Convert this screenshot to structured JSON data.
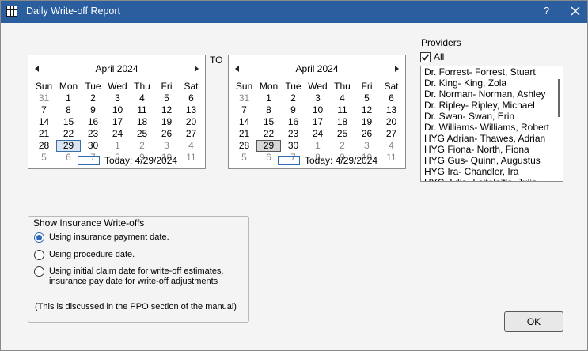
{
  "window": {
    "title": "Daily Write-off Report",
    "help_label": "?"
  },
  "to_label": "TO",
  "calendar_left": {
    "month": "April 2024",
    "weekdays": [
      "Sun",
      "Mon",
      "Tue",
      "Wed",
      "Thu",
      "Fri",
      "Sat"
    ],
    "weeks": [
      [
        "31",
        "1",
        "2",
        "3",
        "4",
        "5",
        "6"
      ],
      [
        "7",
        "8",
        "9",
        "10",
        "11",
        "12",
        "13"
      ],
      [
        "14",
        "15",
        "16",
        "17",
        "18",
        "19",
        "20"
      ],
      [
        "21",
        "22",
        "23",
        "24",
        "25",
        "26",
        "27"
      ],
      [
        "28",
        "29",
        "30",
        "1",
        "2",
        "3",
        "4"
      ],
      [
        "5",
        "6",
        "7",
        "8",
        "9",
        "10",
        "11"
      ]
    ],
    "today_label": "Today: 4/29/2024"
  },
  "calendar_right": {
    "month": "April 2024",
    "weekdays": [
      "Sun",
      "Mon",
      "Tue",
      "Wed",
      "Thu",
      "Fri",
      "Sat"
    ],
    "weeks": [
      [
        "31",
        "1",
        "2",
        "3",
        "4",
        "5",
        "6"
      ],
      [
        "7",
        "8",
        "9",
        "10",
        "11",
        "12",
        "13"
      ],
      [
        "14",
        "15",
        "16",
        "17",
        "18",
        "19",
        "20"
      ],
      [
        "21",
        "22",
        "23",
        "24",
        "25",
        "26",
        "27"
      ],
      [
        "28",
        "29",
        "30",
        "1",
        "2",
        "3",
        "4"
      ],
      [
        "5",
        "6",
        "7",
        "8",
        "9",
        "10",
        "11"
      ]
    ],
    "today_label": "Today: 4/29/2024"
  },
  "providers": {
    "label": "Providers",
    "all_label": "All",
    "all_checked": true,
    "items": [
      "Dr. Forrest- Forrest, Stuart",
      "Dr. King- King, Zola",
      "Dr. Norman- Norman, Ashley",
      "Dr. Ripley- Ripley, Michael",
      "Dr. Swan- Swan, Erin",
      "Dr. Williams- Williams, Robert",
      "HYG Adrian- Thawes, Adrian",
      "HYG Fiona- North, Fiona",
      "HYG Gus- Quinn, Augustus",
      "HYG Ira- Chandler, Ira",
      "HYG Julia- Laitelaitis, Julia"
    ]
  },
  "insurance_writeoffs": {
    "label": "Show Insurance Write-offs",
    "option1": "Using insurance payment date.",
    "option2": "Using procedure date.",
    "option3_line1": "Using initial claim date for write-off estimates,",
    "option3_line2": "insurance pay date for write-off adjustments",
    "selected": "option1",
    "note": "(This is discussed in the PPO section of the manual)"
  },
  "ok_label": "OK"
}
